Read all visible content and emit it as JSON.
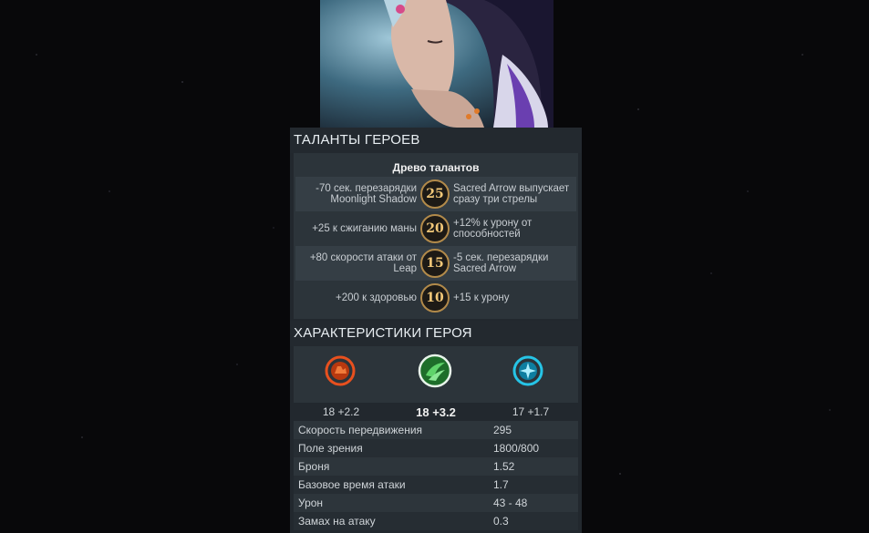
{
  "hero": {
    "portrait_icon": "hero-portrait"
  },
  "talents": {
    "section_title": "ТАЛАНТЫ ГЕРОЕВ",
    "tree_title": "Древо талантов",
    "rows": [
      {
        "level": "25",
        "left": "-70 сек. перезарядки Moonlight Shadow",
        "right": "Sacred Arrow выпускает сразу три стрелы"
      },
      {
        "level": "20",
        "left": "+25 к сжиганию маны",
        "right": "+12% к урону от способностей"
      },
      {
        "level": "15",
        "left": "+80 скорости атаки от Leap",
        "right": "-5 сек. перезарядки Sacred Arrow"
      },
      {
        "level": "10",
        "left": "+200 к здоровью",
        "right": "+15 к урону"
      }
    ]
  },
  "stats": {
    "section_title": "ХАРАКТЕРИСТИКИ ГЕРОЯ",
    "attributes": [
      {
        "icon": "strength-icon",
        "value": "18 +2.2",
        "color": "#e8501e"
      },
      {
        "icon": "agility-icon",
        "value": "18 +3.2",
        "color": "#3fb24a",
        "primary": true
      },
      {
        "icon": "intelligence-icon",
        "value": "17 +1.7",
        "color": "#26c4e6"
      }
    ],
    "rows": [
      {
        "label": "Скорость передвижения",
        "value": "295"
      },
      {
        "label": "Поле зрения",
        "value": "1800/800"
      },
      {
        "label": "Броня",
        "value": "1.52"
      },
      {
        "label": "Базовое время атаки",
        "value": "1.7"
      },
      {
        "label": "Урон",
        "value": "43 - 48"
      },
      {
        "label": "Замах на атаку",
        "value": "0.3"
      }
    ]
  }
}
